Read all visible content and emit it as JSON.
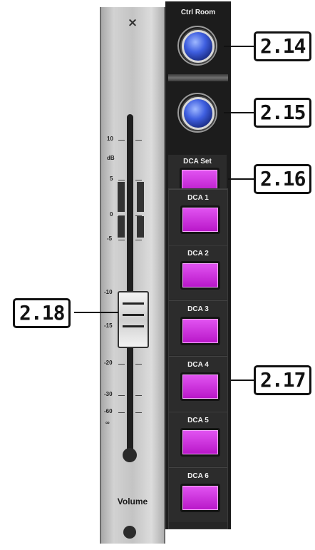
{
  "fader": {
    "close_symbol": "×",
    "scale": [
      "10",
      "dB",
      "5",
      "0",
      "-5",
      "-10",
      "-15",
      "-20",
      "-30",
      "-60",
      "∞"
    ],
    "volume_label": "Volume"
  },
  "panel": {
    "ctrl_room_label": "Ctrl Room",
    "dca_set_label": "DCA Set",
    "dca_labels": [
      "DCA 1",
      "DCA 2",
      "DCA 3",
      "DCA 4",
      "DCA 5",
      "DCA 6"
    ]
  },
  "callouts": {
    "knob_1": "2.14",
    "knob_2": "2.15",
    "dca_set": "2.16",
    "dca_group": "2.17",
    "fader": "2.18"
  },
  "colors": {
    "knob_blue": "#3f5fe0",
    "button_magenta": "#d33be3",
    "panel_dark": "#1c1c1c"
  }
}
